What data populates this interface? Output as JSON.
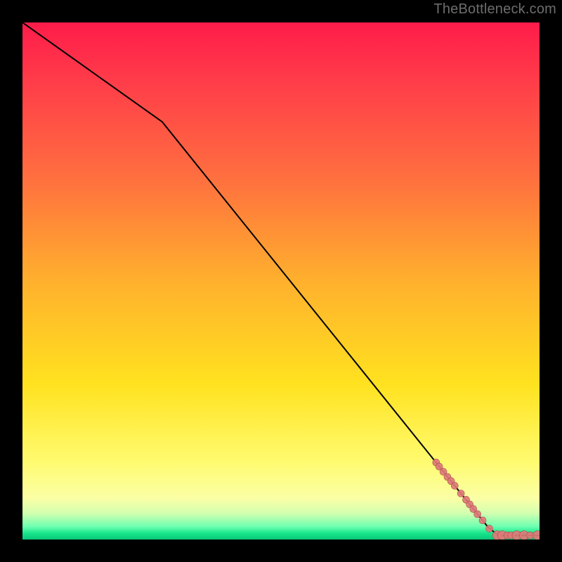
{
  "watermark": "TheBottleneck.com",
  "chart_data": {
    "type": "line",
    "title": "",
    "xlabel": "",
    "ylabel": "",
    "xlim": [
      0,
      100
    ],
    "ylim": [
      0,
      100
    ],
    "grid": false,
    "legend": false,
    "line": {
      "color": "#000000",
      "width": 2,
      "points": [
        {
          "x": 0,
          "y": 100
        },
        {
          "x": 27,
          "y": 80.8
        },
        {
          "x": 90,
          "y": 2.45
        },
        {
          "x": 92,
          "y": 0.8
        },
        {
          "x": 100,
          "y": 0.8
        }
      ]
    },
    "markers": {
      "fill": "#e07a78",
      "stroke": "#a84f4f",
      "opacity": 0.92,
      "r_small": 5,
      "r_large": 6.5,
      "points": [
        {
          "x": 80.0,
          "y": 14.9
        },
        {
          "x": 80.6,
          "y": 14.1
        },
        {
          "x": 81.4,
          "y": 13.1
        },
        {
          "x": 82.2,
          "y": 12.1
        },
        {
          "x": 82.9,
          "y": 11.3
        },
        {
          "x": 83.6,
          "y": 10.4
        },
        {
          "x": 84.8,
          "y": 8.9
        },
        {
          "x": 85.8,
          "y": 7.7
        },
        {
          "x": 86.5,
          "y": 6.8
        },
        {
          "x": 87.2,
          "y": 5.9
        },
        {
          "x": 88.0,
          "y": 4.9
        },
        {
          "x": 89.0,
          "y": 3.7
        },
        {
          "x": 90.3,
          "y": 2.1
        },
        {
          "x": 91.8,
          "y": 0.8,
          "large": true
        },
        {
          "x": 92.8,
          "y": 0.8,
          "large": true
        },
        {
          "x": 93.8,
          "y": 0.8
        },
        {
          "x": 94.5,
          "y": 0.8
        },
        {
          "x": 95.6,
          "y": 0.8,
          "large": true
        },
        {
          "x": 97.0,
          "y": 0.8,
          "large": true
        },
        {
          "x": 98.2,
          "y": 0.8
        },
        {
          "x": 99.6,
          "y": 0.8,
          "large": true
        }
      ]
    },
    "background_gradient": {
      "stops": [
        {
          "pct": 0,
          "color": "#ff1c4a"
        },
        {
          "pct": 50,
          "color": "#ffb02d"
        },
        {
          "pct": 85,
          "color": "#fffb70"
        },
        {
          "pct": 97.5,
          "color": "#6dffb0"
        },
        {
          "pct": 100,
          "color": "#0ac779"
        }
      ]
    }
  }
}
